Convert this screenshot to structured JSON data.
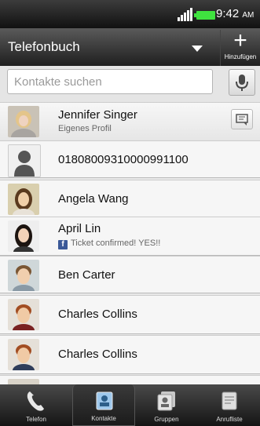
{
  "status_bar": {
    "time": "9:42",
    "ampm": "AM",
    "battery_color": "#3fe23f"
  },
  "header": {
    "title": "Telefonbuch",
    "add_label": "Hinzufügen"
  },
  "search": {
    "placeholder": "Kontakte suchen"
  },
  "contacts": [
    {
      "name": "Jennifer Singer",
      "subtitle": "Eigenes Profil",
      "avatar": "photo-woman-blonde"
    },
    {
      "name": "01808009310000991100",
      "avatar": "default-silhouette"
    },
    {
      "name": "Angela Wang",
      "avatar": "photo-woman"
    },
    {
      "name": "April Lin",
      "subtitle": "Ticket confirmed! YES!!",
      "subtitle_icon": "facebook-icon",
      "avatar": "photo-woman-darkhair"
    },
    {
      "name": "Ben Carter",
      "avatar": "photo-man"
    },
    {
      "name": "Charles Collins",
      "avatar": "photo-man-redhair"
    },
    {
      "name": "Charles Collins",
      "avatar": "photo-man-redhair"
    }
  ],
  "tabs": [
    {
      "label": "Telefon",
      "icon": "phone-icon"
    },
    {
      "label": "Kontakte",
      "icon": "contacts-icon",
      "active": true
    },
    {
      "label": "Gruppen",
      "icon": "groups-icon"
    },
    {
      "label": "Anrufliste",
      "icon": "call-history-icon"
    }
  ],
  "accent_colors": {
    "facebook": "#3b5998",
    "header_text": "#ffffff"
  }
}
